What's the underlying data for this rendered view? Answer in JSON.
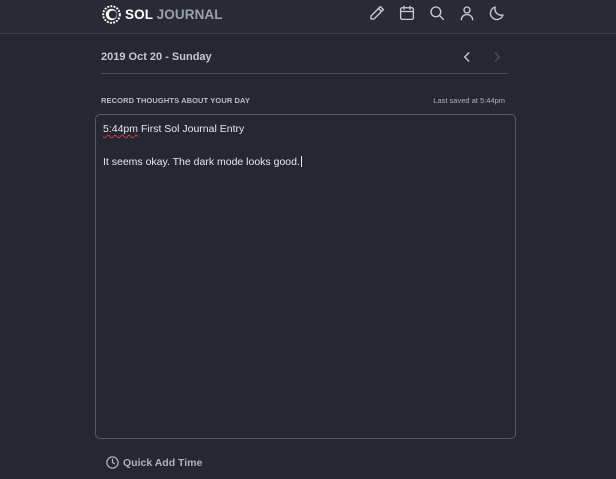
{
  "app": {
    "logo_word1": "SOL",
    "logo_word2": "JOURNAL"
  },
  "nav": {
    "icons": [
      "pencil-icon",
      "calendar-icon",
      "search-icon",
      "user-icon",
      "moon-icon"
    ]
  },
  "date_header": {
    "title": "2019 Oct 20 - Sunday"
  },
  "entry": {
    "section_label": "RECORD THOUGHTS ABOUT YOUR DAY",
    "saved_status": "Last saved at 5:44pm",
    "line1_time": "5:44pm",
    "line1_text": " First Sol Journal Entry",
    "line3_text": "It seems okay. The dark mode looks good."
  },
  "footer": {
    "quick_add_label": "Quick Add Time"
  },
  "colors": {
    "background": "#252833",
    "topbar": "#282b36",
    "text": "#e6e8ec",
    "muted": "#aeb2bb"
  }
}
